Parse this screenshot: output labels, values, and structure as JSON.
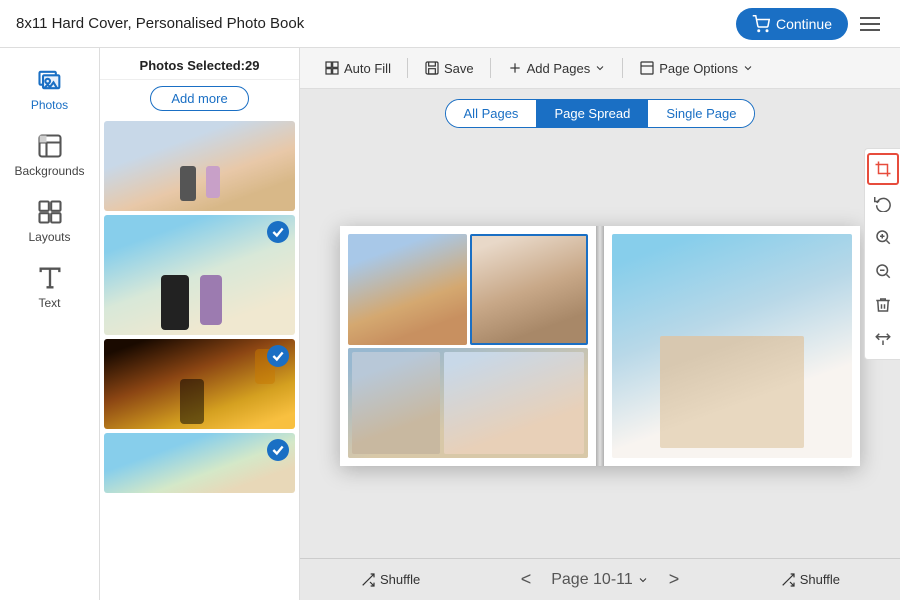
{
  "header": {
    "title": "8x11 Hard Cover, Personalised Photo Book",
    "continue_label": "Continue",
    "hamburger_label": "Menu"
  },
  "sidebar": {
    "items": [
      {
        "id": "photos",
        "label": "Photos",
        "active": true
      },
      {
        "id": "backgrounds",
        "label": "Backgrounds",
        "active": false
      },
      {
        "id": "layouts",
        "label": "Layouts",
        "active": false
      },
      {
        "id": "text",
        "label": "Text",
        "active": false
      }
    ]
  },
  "photo_panel": {
    "header": "Photos Selected:29",
    "add_more_label": "Add more"
  },
  "toolbar": {
    "autofill_label": "Auto Fill",
    "save_label": "Save",
    "add_pages_label": "Add Pages",
    "page_options_label": "Page Options"
  },
  "tabs": [
    {
      "id": "all-pages",
      "label": "All Pages",
      "active": false
    },
    {
      "id": "page-spread",
      "label": "Page Spread",
      "active": true
    },
    {
      "id": "single-page",
      "label": "Single Page",
      "active": false
    }
  ],
  "bottom": {
    "shuffle_left_label": "Shuffle",
    "shuffle_right_label": "Shuffle",
    "page_label": "Page 10-11",
    "prev_label": "<",
    "next_label": ">"
  },
  "right_tools": [
    {
      "id": "crop",
      "label": "Crop",
      "active": true
    },
    {
      "id": "rotate",
      "label": "Rotate",
      "active": false
    },
    {
      "id": "zoom-in",
      "label": "Zoom In",
      "active": false
    },
    {
      "id": "zoom-out",
      "label": "Zoom Out",
      "active": false
    },
    {
      "id": "delete",
      "label": "Delete",
      "active": false
    },
    {
      "id": "flip",
      "label": "Flip",
      "active": false
    }
  ],
  "colors": {
    "primary": "#1a6fc4",
    "active_border": "#e74c3c"
  }
}
